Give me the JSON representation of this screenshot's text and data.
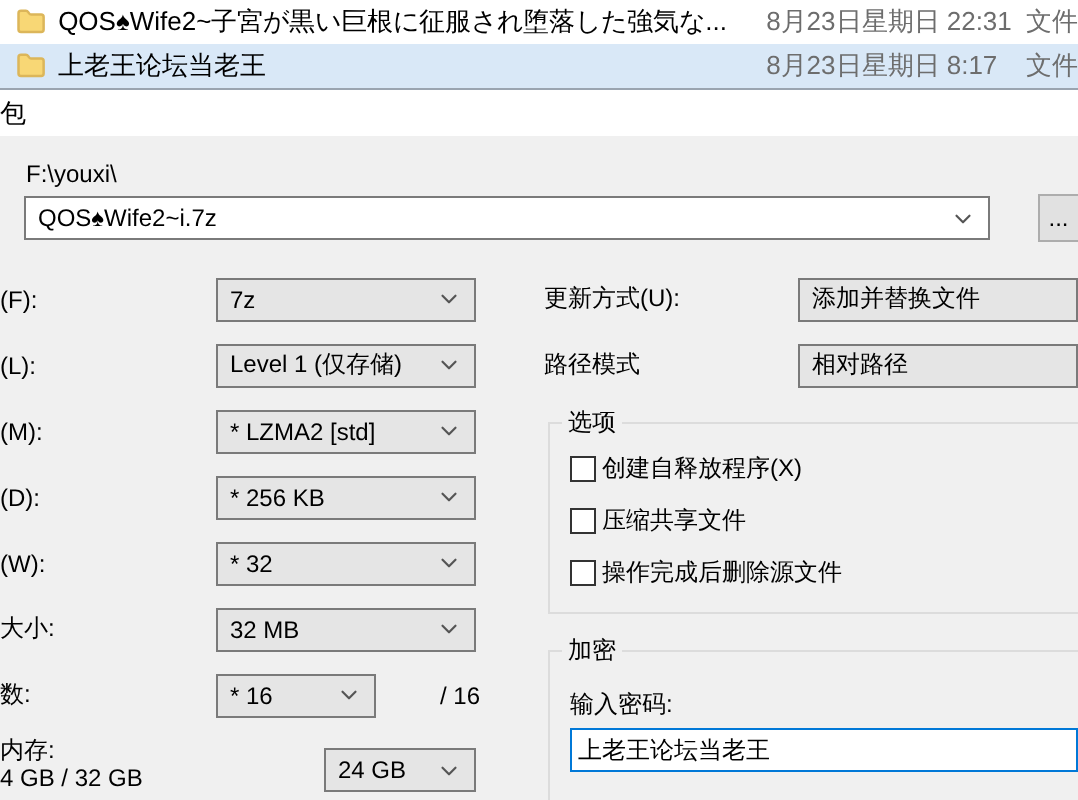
{
  "file_list": [
    {
      "name": "QOS♠Wife2~子宮が黒い巨根に征服され堕落した強気な...",
      "date": "8月23日星期日 22:31",
      "type": "文件",
      "selected": false
    },
    {
      "name": "上老王论坛当老王",
      "date": "8月23日星期日 8:17",
      "type": "文件",
      "selected": true
    }
  ],
  "dialog": {
    "title": "包",
    "archive_folder": "F:\\youxi\\",
    "archive_name": "QOS♠Wife2~i.7z",
    "browse_button": "..."
  },
  "left_settings": [
    {
      "label": "(F):",
      "value": "7z",
      "kind": "select"
    },
    {
      "label": "(L):",
      "value": "Level 1 (仅存储)",
      "kind": "select"
    },
    {
      "label": "(M):",
      "value": "* LZMA2 [std]",
      "kind": "select"
    },
    {
      "label": "(D):",
      "value": "* 256 KB",
      "kind": "select"
    },
    {
      "label": "(W):",
      "value": "* 32",
      "kind": "select"
    },
    {
      "label": "大小:",
      "value": "32 MB",
      "kind": "select"
    },
    {
      "label": "数:",
      "value": "* 16",
      "kind": "short",
      "suffix": "/ 16"
    },
    {
      "label": "内存:",
      "sublabel": "4 GB / 32 GB",
      "value": "24 GB",
      "kind": "memory"
    }
  ],
  "right_settings": [
    {
      "label": "更新方式(U):",
      "value": "添加并替换文件"
    },
    {
      "label": "路径模式",
      "value": "相对路径"
    }
  ],
  "options": {
    "title": "选项",
    "items": [
      {
        "label": "创建自释放程序(X)",
        "checked": false
      },
      {
        "label": "压缩共享文件",
        "checked": false
      },
      {
        "label": "操作完成后删除源文件",
        "checked": false
      }
    ]
  },
  "encryption": {
    "title": "加密",
    "password_label": "输入密码:",
    "password": "上老王论坛当老王"
  }
}
